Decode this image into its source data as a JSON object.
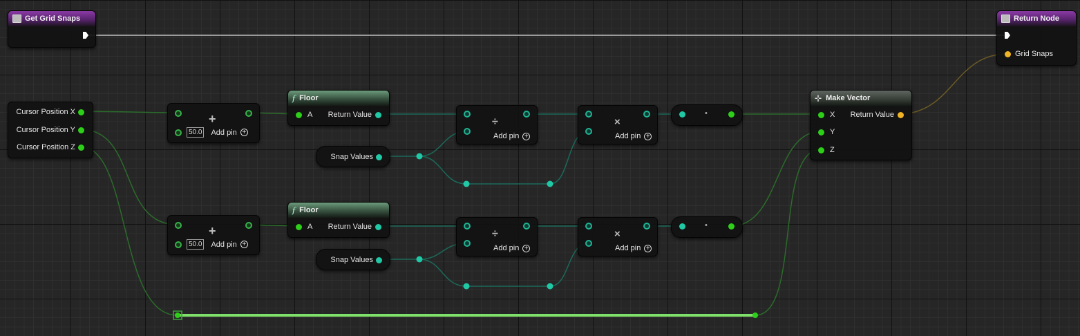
{
  "nodes": {
    "get_grid_snaps": {
      "title": "Get Grid Snaps"
    },
    "return_node": {
      "title": "Return Node",
      "output_label": "Grid Snaps"
    },
    "break_vector": {
      "pins": [
        "Cursor Position X",
        "Cursor Position Y",
        "Cursor Position Z"
      ]
    },
    "add_1": {
      "value": "50.0",
      "add_pin_label": "Add pin"
    },
    "add_2": {
      "value": "50.0",
      "add_pin_label": "Add pin"
    },
    "floor_1": {
      "title": "Floor",
      "input_label": "A",
      "output_label": "Return Value"
    },
    "floor_2": {
      "title": "Floor",
      "input_label": "A",
      "output_label": "Return Value"
    },
    "snap_values_1": {
      "label": "Snap Values"
    },
    "snap_values_2": {
      "label": "Snap Values"
    },
    "divide_1": {
      "add_pin_label": "Add pin"
    },
    "divide_2": {
      "add_pin_label": "Add pin"
    },
    "multiply_1": {
      "add_pin_label": "Add pin"
    },
    "multiply_2": {
      "add_pin_label": "Add pin"
    },
    "make_vector": {
      "title": "Make Vector",
      "inputs": [
        "X",
        "Y",
        "Z"
      ],
      "output_label": "Return Value"
    }
  },
  "colors": {
    "exec": "#ffffff",
    "float_pin": "#2dcf19",
    "vector_pin": "#20c9a6",
    "struct_pin": "#f0b323",
    "function_header": "#4f7a5c",
    "event_header": "#7a2f92"
  },
  "icons": {
    "event": "function-entry-icon",
    "floor": "function-f-icon",
    "make_vector": "make-struct-icon"
  }
}
